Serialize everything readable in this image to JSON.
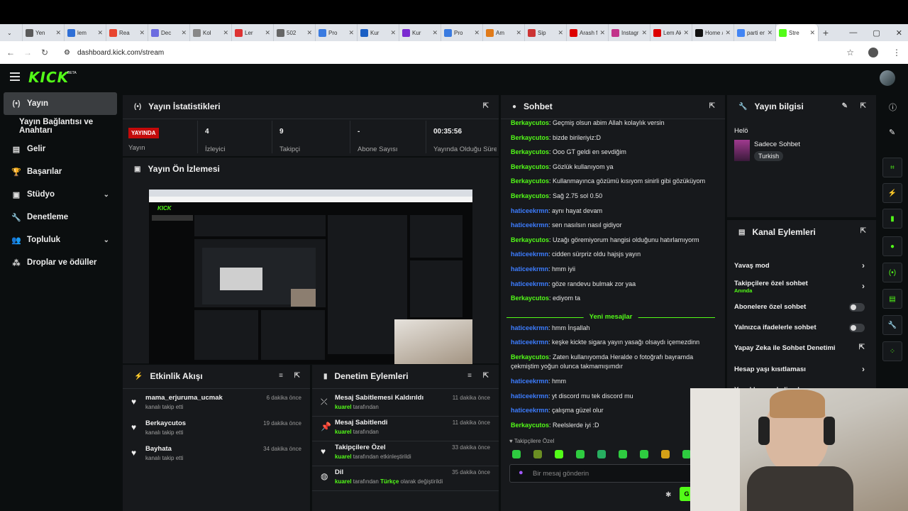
{
  "browser": {
    "tabs": [
      {
        "label": "Yen",
        "color": "#5a5a5a"
      },
      {
        "label": "lem",
        "color": "#2f6fd6"
      },
      {
        "label": "Rea",
        "color": "#e8452f"
      },
      {
        "label": "Dec",
        "color": "#6c6ce0"
      },
      {
        "label": "Kol",
        "color": "#888"
      },
      {
        "label": "Ler",
        "color": "#d33"
      },
      {
        "label": "502",
        "color": "#666"
      },
      {
        "label": "Pro",
        "color": "#3a7be0"
      },
      {
        "label": "Kur",
        "color": "#1a5fc4"
      },
      {
        "label": "Kur",
        "color": "#7b2bd1"
      },
      {
        "label": "Pro",
        "color": "#3a7be0"
      },
      {
        "label": "Am",
        "color": "#e07b1a"
      },
      {
        "label": "Sip",
        "color": "#c33"
      },
      {
        "label": "Arash fo",
        "color": "#d00"
      },
      {
        "label": "Instagra",
        "color": "#c2348a"
      },
      {
        "label": "Lem Ak",
        "color": "#d00"
      },
      {
        "label": "Home /",
        "color": "#111"
      },
      {
        "label": "parti en",
        "color": "#4285f4"
      },
      {
        "label": "Stre",
        "color": "#53fc18",
        "active": true
      }
    ],
    "url": "dashboard.kick.com/stream"
  },
  "app": {
    "logo": "KICK",
    "beta": "BETA"
  },
  "sidebar": {
    "items": [
      {
        "label": "Yayın",
        "icon": "broadcast-icon",
        "active": true
      },
      {
        "label": "Yayın Bağlantısı ve Anahtarı",
        "icon": "",
        "sub": true
      },
      {
        "label": "Gelir",
        "icon": "revenue-icon"
      },
      {
        "label": "Başarılar",
        "icon": "trophy-icon"
      },
      {
        "label": "Stüdyo",
        "icon": "studio-icon",
        "chevron": true
      },
      {
        "label": "Denetleme",
        "icon": "wrench-icon"
      },
      {
        "label": "Topluluk",
        "icon": "community-icon",
        "chevron": true
      },
      {
        "label": "Droplar ve ödüller",
        "icon": "drops-icon"
      }
    ]
  },
  "stats": {
    "title": "Yayın İstatistikleri",
    "live_badge": "YAYINDA",
    "items": [
      {
        "label": "Yayın",
        "value": ""
      },
      {
        "label": "İzleyici",
        "value": "4"
      },
      {
        "label": "Takipçi",
        "value": "9"
      },
      {
        "label": "Abone Sayısı",
        "value": "-"
      },
      {
        "label": "Yayında Olduğu Süre",
        "value": "00:35:56"
      }
    ]
  },
  "preview": {
    "title": "Yayın Ön İzlemesi"
  },
  "activity": {
    "title": "Etkinlik Akışı",
    "items": [
      {
        "name": "mama_erjuruma_ucmak",
        "sub": "kanalı takip etti",
        "when": "6 dakika önce"
      },
      {
        "name": "Berkaycutos",
        "sub": "kanalı takip etti",
        "when": "19 dakika önce"
      },
      {
        "name": "Bayhata",
        "sub": "kanalı takip etti",
        "when": "34 dakika önce"
      }
    ]
  },
  "moderation": {
    "title": "Denetim Eylemleri",
    "items": [
      {
        "title": "Mesaj Sabitlemesi Kaldırıldı",
        "user": "kuarel",
        "rest": " tarafından",
        "when": "11 dakika önce",
        "icon": "unpin-icon"
      },
      {
        "title": "Mesaj Sabitlendi",
        "user": "kuarel",
        "rest": " tarafından",
        "when": "11 dakika önce",
        "icon": "pin-icon"
      },
      {
        "title": "Takipçilere Özel",
        "user": "kuarel",
        "rest": " tarafından etkinleştirildi",
        "when": "33 dakika önce",
        "icon": "heart-icon"
      },
      {
        "title": "Dil",
        "user": "kuarel",
        "rest": " tarafından ",
        "lang": "Türkçe",
        "rest2": " olarak değiştirildi",
        "when": "35 dakika önce",
        "icon": "globe-icon"
      }
    ]
  },
  "chat": {
    "title": "Sohbet",
    "messages": [
      {
        "user": "Berkaycutos",
        "color": "green",
        "text": ": Geçmiş olsun abim Allah kolaylık versin"
      },
      {
        "user": "Berkaycutos",
        "color": "green",
        "text": ": bizde birileriyiz:D"
      },
      {
        "user": "Berkaycutos",
        "color": "green",
        "text": ": Ooo GT geldi en sevdiğim"
      },
      {
        "user": "Berkaycutos",
        "color": "green",
        "text": ": Gözlük kullanıyom ya"
      },
      {
        "user": "Berkaycutos",
        "color": "green",
        "text": ": Kullanmayınca gözümü kısıyom sinirli gibi gözüküyom"
      },
      {
        "user": "Berkaycutos",
        "color": "green",
        "text": ": Sağ 2.75 sol 0.50"
      },
      {
        "user": "haticeekrmn",
        "color": "blue",
        "text": ": aynı hayat devam"
      },
      {
        "user": "haticeekrmn",
        "color": "blue",
        "text": ": sen nasılsın nasıl gidiyor"
      },
      {
        "user": "Berkaycutos",
        "color": "green",
        "text": ": Uzağı göremiyorum hangisi olduğunu hatırlamıyorm"
      },
      {
        "user": "haticeekrmn",
        "color": "blue",
        "text": ": cidden sürpriz oldu hajsjs yayın"
      },
      {
        "user": "haticeekrmn",
        "color": "blue",
        "text": ": hmm iyii"
      },
      {
        "user": "haticeekrmn",
        "color": "blue",
        "text": ": göze randevu bulmak zor yaa"
      },
      {
        "user": "Berkaycutos",
        "color": "green",
        "text": ": ediyom ta"
      }
    ],
    "new_messages_label": "Yeni mesajlar",
    "messages2": [
      {
        "user": "haticeekrmn",
        "color": "blue",
        "text": ": hmm İnşallah"
      },
      {
        "user": "haticeekrmn",
        "color": "blue",
        "text": ": keşke kickte sigara yayın yasağı olsaydı içemezdinn"
      },
      {
        "user": "Berkaycutos",
        "color": "green",
        "text": ": Zaten kullanıyomda Heralde o fotoğrafı bayramda"
      },
      {
        "user": "",
        "color": "green",
        "text": "çekmiştim yoğun olunca takmamışımdır"
      },
      {
        "user": "haticeekrmn",
        "color": "blue",
        "text": ": hmm"
      },
      {
        "user": "haticeekrmn",
        "color": "blue",
        "text": ": yt discord mu tek discord mu"
      },
      {
        "user": "haticeekrmn",
        "color": "blue",
        "text": ": çalışma güzel olur"
      },
      {
        "user": "Berkaycutos",
        "color": "green",
        "text": ": Reelslerde iyi :D"
      }
    ],
    "followers_only": "Takipçilere Özel",
    "input_placeholder": "Bir mesaj gönderin",
    "send_label": "G"
  },
  "stream_info": {
    "title": "Yayın bilgisi",
    "stream_title": "Helö",
    "category": "Sadece Sohbet",
    "tag": "Turkish"
  },
  "channel_actions": {
    "title": "Kanal Eylemleri",
    "rows": [
      {
        "label": "Yavaş mod",
        "kind": "arrow"
      },
      {
        "label": "Takipçilere özel sohbet",
        "sub": "Anında",
        "kind": "arrow"
      },
      {
        "label": "Abonelere özel sohbet",
        "kind": "toggle"
      },
      {
        "label": "Yalnızca ifadelerle sohbet",
        "kind": "toggle"
      },
      {
        "label": "Yapay Zeka ile Sohbet Denetimi",
        "kind": "external"
      },
      {
        "label": "Hesap yaşı kısıtlaması",
        "kind": "arrow"
      },
      {
        "label": "Yasaklanmış kelimeler",
        "kind": "arrow"
      }
    ]
  },
  "colors": {
    "accent": "#53fc18",
    "live": "#c40a0a",
    "user_blue": "#3d7dff",
    "panel": "#17191c",
    "bg": "#0b0e0f"
  }
}
